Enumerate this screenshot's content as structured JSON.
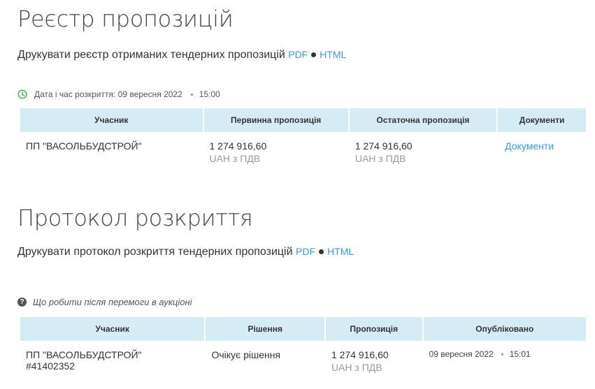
{
  "registry": {
    "title": "Реєстр пропозицій",
    "print_text": "Друкувати реєстр отриманих тендерних пропозицій",
    "pdf_label": "PDF",
    "html_label": "HTML",
    "opening_label": "Дата і час розкриття: 09 вересня 2022",
    "opening_time": "15:00",
    "columns": [
      "Учасник",
      "Первинна пропозиція",
      "Остаточна пропозиція",
      "Документи"
    ],
    "rows": [
      {
        "participant": "ПП \"ВАСОЛЬБУДСТРОЙ\"",
        "initial_amount": "1 274 916,60",
        "initial_currency": "UAH з ПДВ",
        "final_amount": "1 274 916,60",
        "final_currency": "UAH з ПДВ",
        "documents_link": "Документи"
      }
    ]
  },
  "protocol": {
    "title": "Протокол розкриття",
    "print_text": "Друкувати протокол розкриття тендерних пропозицій",
    "pdf_label": "PDF",
    "html_label": "HTML",
    "help_text": "Що робити після перемоги в аукціоні",
    "columns": [
      "Учасник",
      "Рішення",
      "Пропозиція",
      "Опубліковано"
    ],
    "rows": [
      {
        "participant": "ПП \"ВАСОЛЬБУДСТРОЙ\"",
        "participant_id": "#41402352",
        "decision": "Очікує рішення",
        "amount": "1 274 916,60",
        "currency": "UAH з ПДВ",
        "published_date": "09 вересня 2022",
        "published_time": "15:01"
      }
    ]
  },
  "colors": {
    "link": "#3a9bd5",
    "header_bg": "#d6ecf3",
    "clock_green": "#4caf50"
  },
  "icons": {
    "clock": "clock-icon",
    "help": "question-circle-icon"
  }
}
